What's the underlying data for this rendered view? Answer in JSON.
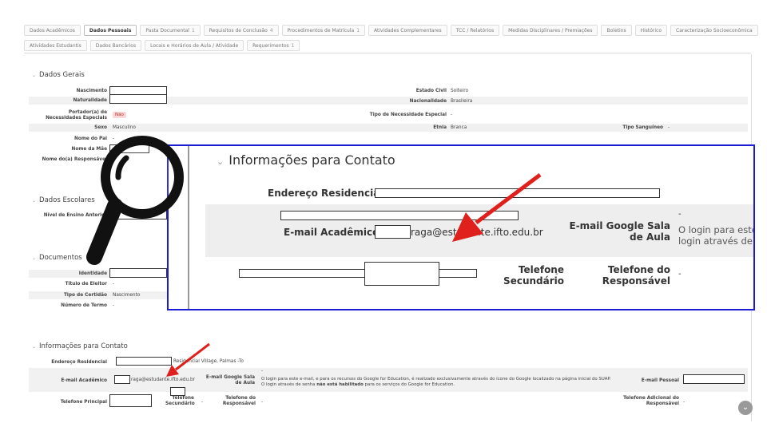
{
  "tabs_row1": [
    {
      "label": "Dados Acadêmicos",
      "count": ""
    },
    {
      "label": "Dados Pessoais",
      "count": "",
      "active": true
    },
    {
      "label": "Pasta Documental",
      "count": "1"
    },
    {
      "label": "Requisitos de Conclusão",
      "count": "4"
    },
    {
      "label": "Procedimentos de Matrícula",
      "count": "1"
    },
    {
      "label": "Atividades Complementares",
      "count": ""
    },
    {
      "label": "TCC / Relatórios",
      "count": ""
    },
    {
      "label": "Medidas Disciplinares / Premiações",
      "count": ""
    },
    {
      "label": "Boletins",
      "count": ""
    },
    {
      "label": "Histórico",
      "count": ""
    },
    {
      "label": "Caracterização Socioeconômica",
      "count": ""
    }
  ],
  "tabs_row2": [
    {
      "label": "Atividades Estudantis",
      "count": ""
    },
    {
      "label": "Dados Bancários",
      "count": ""
    },
    {
      "label": "Locais e Horários de Aula / Atividade",
      "count": ""
    },
    {
      "label": "Requerimentos",
      "count": "1"
    }
  ],
  "dados_gerais": {
    "title": "Dados Gerais",
    "nascimento": "Nascimento",
    "naturalidade": "Naturalidade",
    "portador": "Portador(a) de Necessidades Especiais",
    "portador_val": "Não",
    "sexo": "Sexo",
    "sexo_val": "Masculino",
    "nome_pai": "Nome do Pai",
    "nome_pai_val": "-",
    "nome_mae": "Nome da Mãe",
    "nome_resp": "Nome do(a) Responsável",
    "nome_resp_val": "-",
    "estado_civil": "Estado Civil",
    "estado_civil_val": "Solteiro",
    "nacionalidade": "Nacionalidade",
    "nacionalidade_val": "Brasileira",
    "tipo_nec": "Tipo de Necessidade Especial",
    "tipo_nec_val": "-",
    "etnia": "Etnia",
    "etnia_val": "Branca",
    "tipo_sang": "Tipo Sanguíneo",
    "tipo_sang_val": "-"
  },
  "dados_escolares": {
    "title": "Dados Escolares",
    "nivel": "Nível de Ensino Anterior"
  },
  "documentos": {
    "title": "Documentos",
    "identidade": "Identidade",
    "titulo": "Título de Eleitor",
    "titulo_val": "-",
    "tipo_cert": "Tipo de Certidão",
    "tipo_cert_val": "Nascimento",
    "num_termo": "Número de Termo",
    "num_termo_val": "-"
  },
  "contato": {
    "title": "Informações para Contato",
    "endereco": "Endereço Residencial",
    "endereco_val": "Residencial Village, Palmas -To",
    "email_acad": "E-mail Acadêmico",
    "email_acad_val": "raga@estudante.ifto.edu.br",
    "email_google": "E-mail Google Sala de Aula",
    "email_google_dash": "-",
    "email_google_val_a": "O login para este e-mail, e para os recursos do Google for Education, é realizado exclusivamente através do ícone do Google localizado na página inicial do SUAP. O login através de senha ",
    "email_google_val_b": "não está habilitado",
    "email_google_val_c": " para os serviços do Google for Education.",
    "email_pessoal": "E-mail Pessoal",
    "tel_principal": "Telefone Principal",
    "tel_sec": "Telefone Secundário",
    "tel_sec_val": "-",
    "tel_resp": "Telefone do Responsável",
    "tel_resp_val": "-",
    "tel_adic": "Telefone Adicional do Responsável",
    "tel_adic_val": "-"
  },
  "zoom": {
    "title": "Informações para Contato",
    "endereco": "Endereço Residencial",
    "email_acad": "E-mail Acadêmico",
    "email_acad_val": "raga@estudante.ifto.edu.br",
    "email_google": "E-mail Google Sala de Aula",
    "email_google_dash": "-",
    "email_google_val": "O login para este",
    "email_google_val2": "login através de s",
    "tel_sec": "Telefone Secundário",
    "tel_sec_val": "-",
    "tel_resp": "Telefone do Responsável",
    "tel_resp_val": "-"
  },
  "colors": {
    "zoom_border": "#1b1bd6",
    "arrow": "#e0201c"
  },
  "icons": {
    "lens": "magnifier-icon",
    "scroll": "chevron-down-icon",
    "arrow": "arrow-icon"
  }
}
